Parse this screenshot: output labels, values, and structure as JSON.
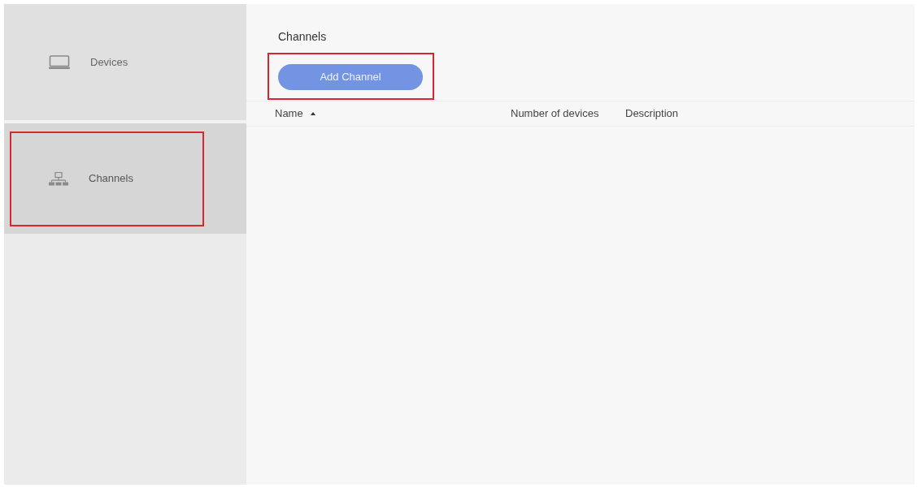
{
  "sidebar": {
    "items": [
      {
        "label": "Devices",
        "selected": false,
        "highlighted": false
      },
      {
        "label": "Channels",
        "selected": true,
        "highlighted": true
      }
    ]
  },
  "main": {
    "title": "Channels",
    "add_button": {
      "label": "Add Channel",
      "highlighted": true
    },
    "table": {
      "columns": [
        {
          "label": "Name",
          "sorted": true
        },
        {
          "label": "Number of devices",
          "sorted": false
        },
        {
          "label": "Description",
          "sorted": false
        }
      ]
    }
  }
}
